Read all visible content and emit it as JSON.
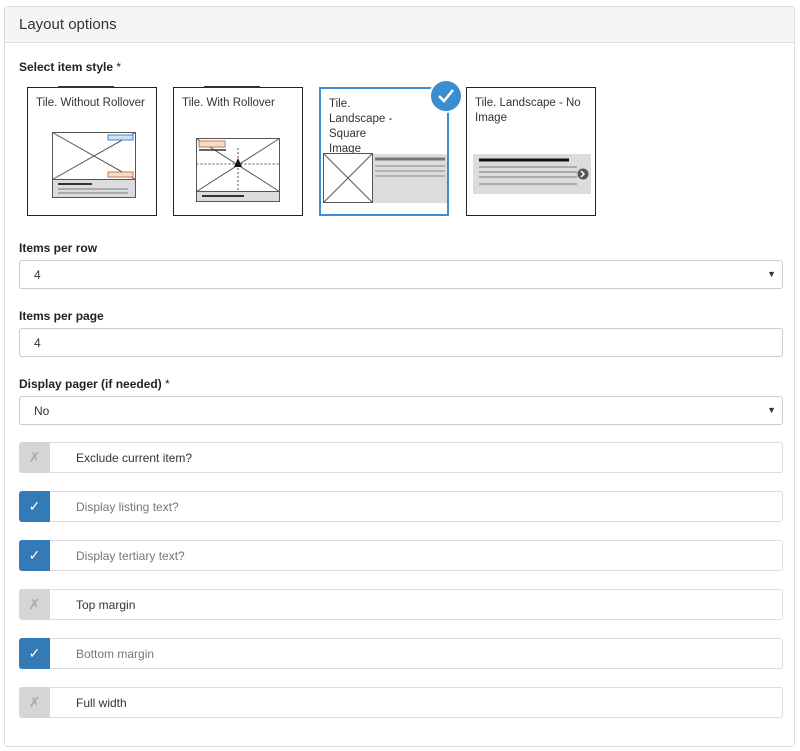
{
  "panel": {
    "title": "Layout options"
  },
  "item_style": {
    "label": "Select item style",
    "required_mark": "*",
    "tiles": [
      {
        "label": "Tile. Without Rollover",
        "selected": false
      },
      {
        "label": "Tile. With Rollover",
        "selected": false
      },
      {
        "label": "Tile. Landscape - Square Image",
        "selected": true
      },
      {
        "label": "Tile. Landscape - No Image",
        "selected": false
      }
    ],
    "selected_icon": "check-icon"
  },
  "items_per_row": {
    "label": "Items per row",
    "value": "4"
  },
  "items_per_page": {
    "label": "Items per page",
    "value": "4"
  },
  "display_pager": {
    "label": "Display pager (if needed)",
    "required_mark": "*",
    "value": "No"
  },
  "toggles": [
    {
      "label": "Exclude current item?",
      "checked": false,
      "icon": "x-icon"
    },
    {
      "label": "Display listing text?",
      "checked": true,
      "icon": "check-icon"
    },
    {
      "label": "Display tertiary text?",
      "checked": true,
      "icon": "check-icon"
    },
    {
      "label": "Top margin",
      "checked": false,
      "icon": "x-icon"
    },
    {
      "label": "Bottom margin",
      "checked": true,
      "icon": "check-icon"
    },
    {
      "label": "Full width",
      "checked": false,
      "icon": "x-icon"
    }
  ],
  "colors": {
    "accent": "#337ab7",
    "selected_border": "#3c8dd0",
    "unchecked": "#d5d5d5"
  }
}
